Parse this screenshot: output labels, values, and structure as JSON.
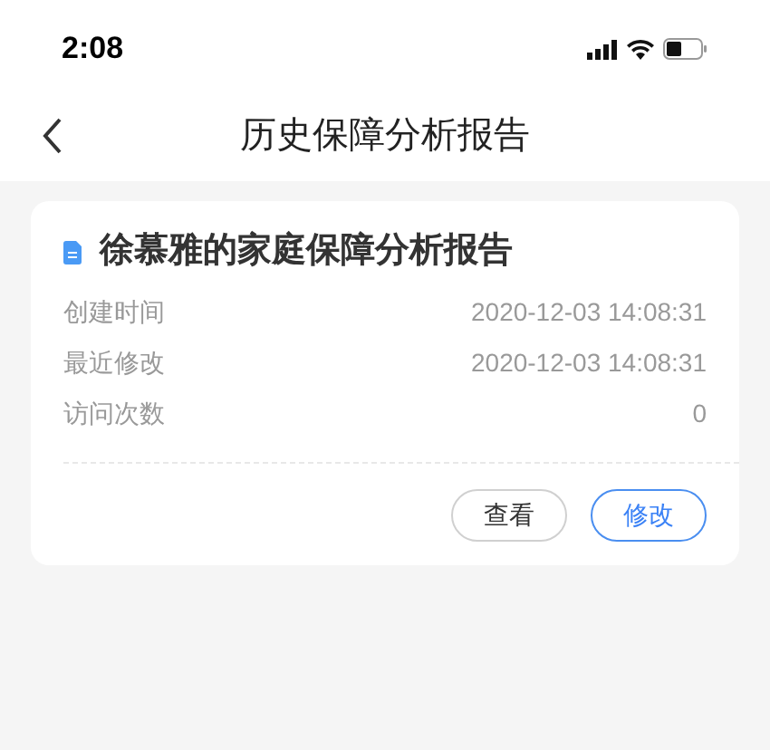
{
  "status_bar": {
    "time": "2:08"
  },
  "nav": {
    "title": "历史保障分析报告"
  },
  "card": {
    "title": "徐慕雅的家庭保障分析报告",
    "rows": [
      {
        "label": "创建时间",
        "value": "2020-12-03 14:08:31"
      },
      {
        "label": "最近修改",
        "value": "2020-12-03 14:08:31"
      },
      {
        "label": "访问次数",
        "value": "0"
      }
    ],
    "buttons": [
      {
        "label": "查看",
        "kind": "default"
      },
      {
        "label": "修改",
        "kind": "primary"
      }
    ]
  }
}
